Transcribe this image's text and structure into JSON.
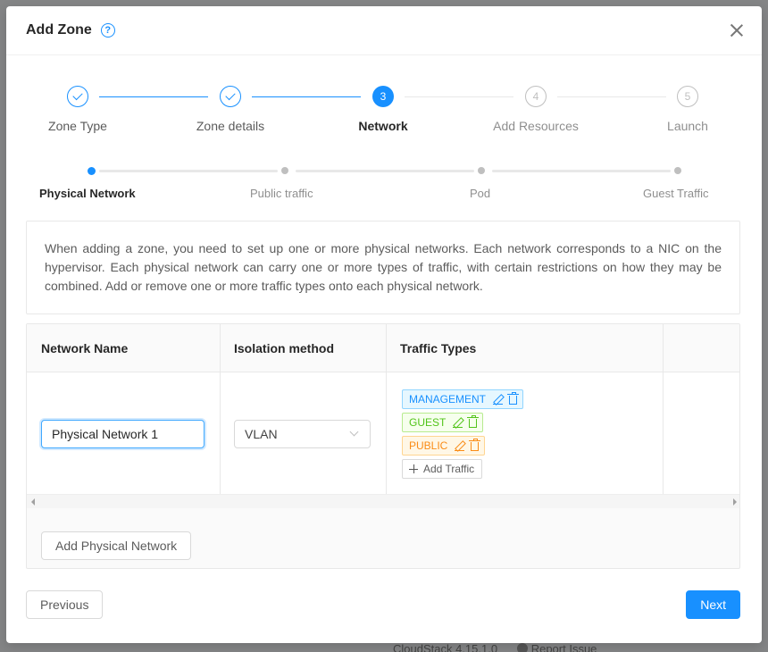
{
  "background": {
    "footer_version": "CloudStack 4.15.1.0",
    "footer_report": "Report Issue"
  },
  "modal": {
    "title": "Add Zone",
    "help_icon": "?"
  },
  "steps": [
    {
      "label": "Zone Type",
      "state": "done",
      "number": "1"
    },
    {
      "label": "Zone details",
      "state": "done",
      "number": "2"
    },
    {
      "label": "Network",
      "state": "active",
      "number": "3"
    },
    {
      "label": "Add Resources",
      "state": "wait",
      "number": "4"
    },
    {
      "label": "Launch",
      "state": "wait",
      "number": "5"
    }
  ],
  "substeps": [
    {
      "label": "Physical Network",
      "state": "active"
    },
    {
      "label": "Public traffic",
      "state": "wait"
    },
    {
      "label": "Pod",
      "state": "wait"
    },
    {
      "label": "Guest Traffic",
      "state": "wait"
    }
  ],
  "description": "When adding a zone, you need to set up one or more physical networks. Each network corresponds to a NIC on the hypervisor. Each physical network can carry one or more types of traffic, with certain restrictions on how they may be combined. Add or remove one or more traffic types onto each physical network.",
  "table": {
    "headers": [
      "Network Name",
      "Isolation method",
      "Traffic Types"
    ],
    "row": {
      "network_name": "Physical Network 1",
      "isolation": "VLAN",
      "traffic": [
        "MANAGEMENT",
        "GUEST",
        "PUBLIC"
      ]
    },
    "add_traffic_label": "Add Traffic"
  },
  "buttons": {
    "add_physical_network": "Add Physical Network",
    "previous": "Previous",
    "next": "Next"
  },
  "colors": {
    "primary": "#1890ff",
    "management": "#1890ff",
    "guest": "#52c41a",
    "public": "#fa8c16"
  }
}
